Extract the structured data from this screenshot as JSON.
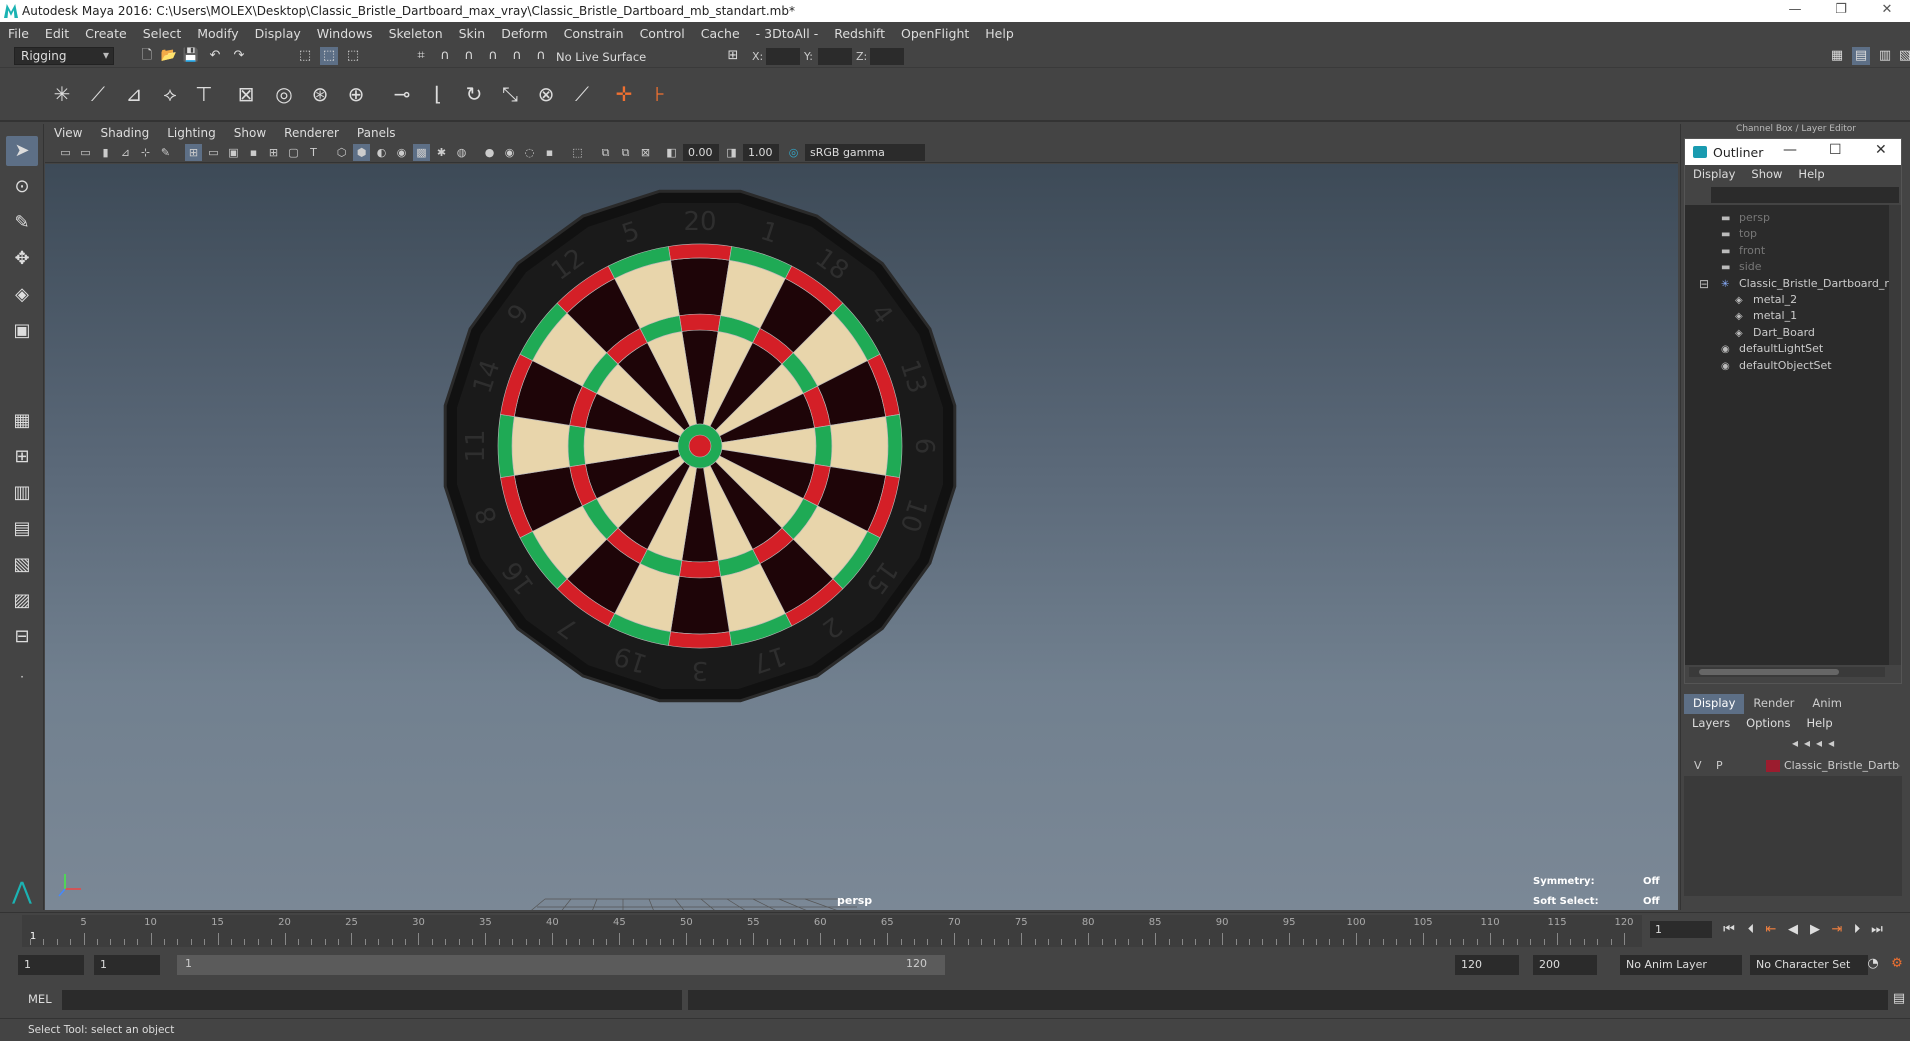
{
  "window": {
    "title": "Autodesk Maya 2016: C:\\Users\\MOLEX\\Desktop\\Classic_Bristle_Dartboard_max_vray\\Classic_Bristle_Dartboard_mb_standart.mb*",
    "minimize": "—",
    "restore": "❐",
    "close": "✕"
  },
  "menubar": [
    "File",
    "Edit",
    "Create",
    "Select",
    "Modify",
    "Display",
    "Windows",
    "Skeleton",
    "Skin",
    "Deform",
    "Constrain",
    "Control",
    "Cache",
    "- 3DtoAll -",
    "Redshift",
    "OpenFlight",
    "Help"
  ],
  "status": {
    "menuset": "Rigging",
    "live_surface": "No Live Surface",
    "x_label": "X:",
    "y_label": "Y:",
    "z_label": "Z:"
  },
  "viewport_menu": [
    "View",
    "Shading",
    "Lighting",
    "Show",
    "Renderer",
    "Panels"
  ],
  "viewport_toolbar": {
    "near": "0.00",
    "far": "1.00",
    "colorspace": "sRGB gamma"
  },
  "viewport": {
    "camera": "persp",
    "symmetry_label": "Symmetry:",
    "symmetry_value": "Off",
    "soft_select_label": "Soft Select:",
    "soft_select_value": "Off"
  },
  "dartboard": {
    "numbers": [
      "20",
      "1",
      "18",
      "4",
      "13",
      "6",
      "10",
      "15",
      "2",
      "17",
      "3",
      "19",
      "7",
      "16",
      "8",
      "11",
      "14",
      "9",
      "12",
      "5"
    ],
    "colors": {
      "dark": "#1e0508",
      "light": "#e8d5ab",
      "red": "#d41f27",
      "green": "#1faa55",
      "rim": "#1a1a1a"
    }
  },
  "right_panel": {
    "title": "Channel Box / Layer Editor"
  },
  "outliner": {
    "title": "Outliner",
    "minimize": "—",
    "maximize": "☐",
    "close": "✕",
    "menu": [
      "Display",
      "Show",
      "Help"
    ],
    "items": [
      {
        "label": "persp",
        "icon": "camera-icon",
        "dim": true,
        "indent": 0
      },
      {
        "label": "top",
        "icon": "camera-icon",
        "dim": true,
        "indent": 0
      },
      {
        "label": "front",
        "icon": "camera-icon",
        "dim": true,
        "indent": 0
      },
      {
        "label": "side",
        "icon": "camera-icon",
        "dim": true,
        "indent": 0
      },
      {
        "label": "Classic_Bristle_Dartboard_r",
        "icon": "group-icon",
        "dim": false,
        "indent": 0
      },
      {
        "label": "metal_2",
        "icon": "mesh-icon",
        "dim": false,
        "indent": 1
      },
      {
        "label": "metal_1",
        "icon": "mesh-icon",
        "dim": false,
        "indent": 1
      },
      {
        "label": "Dart_Board",
        "icon": "mesh-icon",
        "dim": false,
        "indent": 1
      },
      {
        "label": "defaultLightSet",
        "icon": "set-icon",
        "dim": false,
        "indent": 0
      },
      {
        "label": "defaultObjectSet",
        "icon": "set-icon",
        "dim": false,
        "indent": 0
      }
    ]
  },
  "layer_editor": {
    "tabs": [
      "Display",
      "Render",
      "Anim"
    ],
    "menu": [
      "Layers",
      "Options",
      "Help"
    ],
    "layer": {
      "v": "V",
      "p": "P",
      "name": "Classic_Bristle_Dartboard",
      "color": "#9b1c2e"
    }
  },
  "timeline": {
    "start": 1,
    "end": 120,
    "labels": [
      "5",
      "10",
      "15",
      "20",
      "25",
      "30",
      "35",
      "40",
      "45",
      "50",
      "55",
      "60",
      "65",
      "70",
      "75",
      "80",
      "85",
      "90",
      "95",
      "100",
      "105",
      "110",
      "115",
      "120"
    ],
    "current_frame": "1",
    "current_marker": "1"
  },
  "range": {
    "start": "1",
    "anim_start": "1",
    "slider_start": "1",
    "slider_end": "120",
    "anim_end": "120",
    "end": "200",
    "anim_layer": "No Anim Layer",
    "char_set": "No Character Set"
  },
  "cmdline": {
    "label": "MEL"
  },
  "helpline": "Select Tool: select an object"
}
